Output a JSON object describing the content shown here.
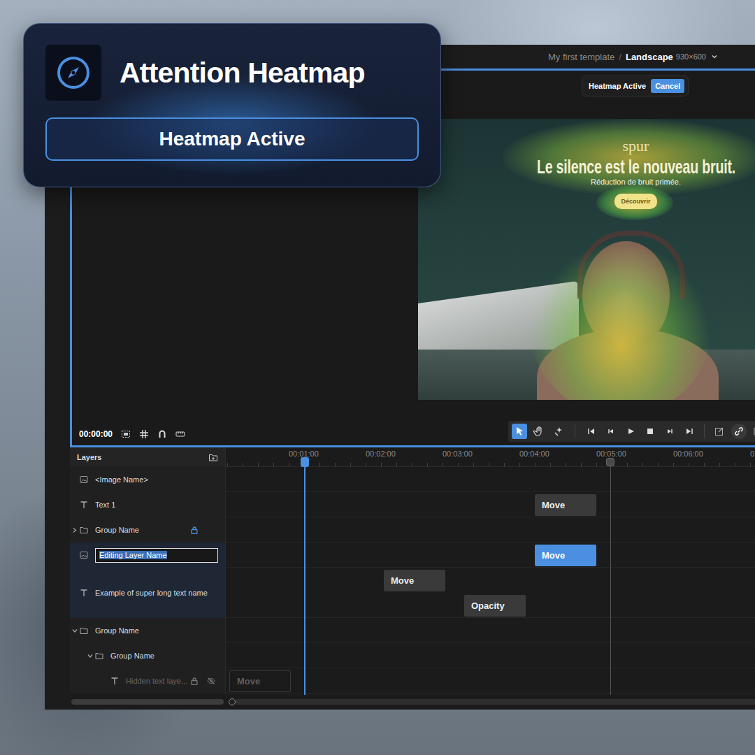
{
  "overlay": {
    "title": "Attention Heatmap",
    "button": "Heatmap Active"
  },
  "breadcrumb": {
    "project": "My first template",
    "separator": "/",
    "format": "Landscape",
    "size": "930×600"
  },
  "heatmap_bar": {
    "status": "Heatmap Active",
    "cancel": "Cancel"
  },
  "canvas": {
    "brand": "spur",
    "headline": "Le silence est le nouveau bruit.",
    "subline": "Réduction de bruit primée.",
    "cta": "Découvrir"
  },
  "timecode": "00:00:00",
  "tools": [
    {
      "kind": "pointer",
      "selected": true
    },
    {
      "kind": "hand",
      "selected": false
    },
    {
      "kind": "sparkle",
      "selected": false
    }
  ],
  "ruler": {
    "ticks": [
      "00:01:00",
      "00:02:00",
      "00:03:00",
      "00:04:00",
      "00:05:00",
      "00:06:00",
      "0"
    ]
  },
  "layers": {
    "title": "Layers",
    "items": [
      {
        "label": "<Image Name>",
        "kind": "image",
        "selected": false,
        "editing": false,
        "locked": false,
        "hidden": false,
        "clips": []
      },
      {
        "label": "Text 1",
        "kind": "text",
        "selected": false,
        "editing": false,
        "locked": false,
        "hidden": false,
        "clips": [
          {
            "label": "Move",
            "selected": false
          }
        ]
      },
      {
        "label": "Group Name",
        "kind": "group",
        "expanded": false,
        "selected": false,
        "editing": false,
        "locked": true,
        "hidden": false,
        "clips": [],
        "children": []
      },
      {
        "label": "Editing Layer Name",
        "kind": "image",
        "selected": true,
        "editing": true,
        "locked": false,
        "hidden": false,
        "clips": [
          {
            "label": "Move",
            "selected": true
          }
        ]
      },
      {
        "label": "Example of super long text name",
        "kind": "text",
        "selected": true,
        "editing": false,
        "locked": false,
        "hidden": false,
        "clips": [
          {
            "label": "Move",
            "selected": false
          },
          {
            "label": "Opacity",
            "selected": false
          }
        ]
      },
      {
        "label": "Group Name",
        "kind": "group",
        "expanded": true,
        "selected": false,
        "editing": false,
        "locked": false,
        "hidden": false,
        "clips": [],
        "children": [
          {
            "label": "Group Name",
            "kind": "group",
            "expanded": true,
            "selected": false,
            "editing": false,
            "locked": false,
            "hidden": false,
            "clips": [],
            "children": [
              {
                "label": "Hidden text laye...",
                "kind": "text",
                "selected": false,
                "editing": false,
                "locked": true,
                "hidden": true,
                "clips": [
                  {
                    "label": "Move",
                    "selected": false
                  }
                ]
              }
            ]
          }
        ]
      }
    ]
  }
}
